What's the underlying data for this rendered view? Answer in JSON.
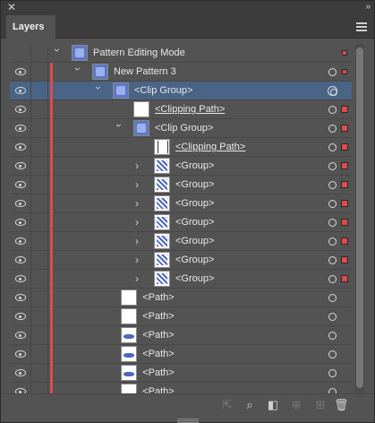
{
  "panel": {
    "close_glyph": "✕",
    "collapse_glyph": "»",
    "tab_label": "Layers"
  },
  "rows": [
    {
      "label": "Pattern Editing Mode",
      "eye": false,
      "color_bar": false,
      "caret": "down",
      "thumb": "blue",
      "indent": 1,
      "underline": false,
      "target": "none",
      "select": "small",
      "selected": false
    },
    {
      "label": "New Pattern 3",
      "eye": true,
      "color_bar": true,
      "caret": "down",
      "thumb": "blue",
      "indent": 2,
      "underline": false,
      "target": "single",
      "select": "small",
      "selected": false
    },
    {
      "label": "<Clip Group>",
      "eye": true,
      "color_bar": true,
      "caret": "down",
      "thumb": "blue",
      "indent": 3,
      "underline": false,
      "target": "double",
      "select": "none",
      "selected": true
    },
    {
      "label": "<Clipping Path>",
      "eye": true,
      "color_bar": true,
      "caret": "none",
      "thumb": "white",
      "indent": 4,
      "underline": true,
      "target": "single",
      "select": "square",
      "selected": false
    },
    {
      "label": "<Clip Group>",
      "eye": true,
      "color_bar": true,
      "caret": "down",
      "thumb": "blue",
      "indent": 4,
      "underline": false,
      "target": "single",
      "select": "square",
      "selected": false
    },
    {
      "label": "<Clipping Path>",
      "eye": true,
      "color_bar": true,
      "caret": "none",
      "thumb": "clip",
      "indent": 5,
      "underline": true,
      "target": "single",
      "select": "square",
      "selected": false
    },
    {
      "label": "<Group>",
      "eye": true,
      "color_bar": true,
      "caret": "right",
      "thumb": "pattern",
      "indent": 5,
      "underline": false,
      "target": "single",
      "select": "square",
      "selected": false
    },
    {
      "label": "<Group>",
      "eye": true,
      "color_bar": true,
      "caret": "right",
      "thumb": "pattern",
      "indent": 5,
      "underline": false,
      "target": "single",
      "select": "square",
      "selected": false
    },
    {
      "label": "<Group>",
      "eye": true,
      "color_bar": true,
      "caret": "right",
      "thumb": "pattern",
      "indent": 5,
      "underline": false,
      "target": "single",
      "select": "square",
      "selected": false
    },
    {
      "label": "<Group>",
      "eye": true,
      "color_bar": true,
      "caret": "right",
      "thumb": "pattern",
      "indent": 5,
      "underline": false,
      "target": "single",
      "select": "square",
      "selected": false
    },
    {
      "label": "<Group>",
      "eye": true,
      "color_bar": true,
      "caret": "right",
      "thumb": "pattern",
      "indent": 5,
      "underline": false,
      "target": "single",
      "select": "square",
      "selected": false
    },
    {
      "label": "<Group>",
      "eye": true,
      "color_bar": true,
      "caret": "right",
      "thumb": "pattern",
      "indent": 5,
      "underline": false,
      "target": "single",
      "select": "square",
      "selected": false
    },
    {
      "label": "<Group>",
      "eye": true,
      "color_bar": true,
      "caret": "right",
      "thumb": "pattern",
      "indent": 5,
      "underline": false,
      "target": "single",
      "select": "square",
      "selected": false
    },
    {
      "label": "<Path>",
      "eye": true,
      "color_bar": true,
      "caret": "none",
      "thumb": "white",
      "indent": 3.4,
      "underline": false,
      "target": "single",
      "select": "none",
      "selected": false
    },
    {
      "label": "<Path>",
      "eye": true,
      "color_bar": true,
      "caret": "none",
      "thumb": "white",
      "indent": 3.4,
      "underline": false,
      "target": "single",
      "select": "none",
      "selected": false
    },
    {
      "label": "<Path>",
      "eye": true,
      "color_bar": true,
      "caret": "none",
      "thumb": "spot",
      "indent": 3.4,
      "underline": false,
      "target": "single",
      "select": "none",
      "selected": false
    },
    {
      "label": "<Path>",
      "eye": true,
      "color_bar": true,
      "caret": "none",
      "thumb": "spot",
      "indent": 3.4,
      "underline": false,
      "target": "single",
      "select": "none",
      "selected": false
    },
    {
      "label": "<Path>",
      "eye": true,
      "color_bar": true,
      "caret": "none",
      "thumb": "spot",
      "indent": 3.4,
      "underline": false,
      "target": "single",
      "select": "none",
      "selected": false
    },
    {
      "label": "<Path>",
      "eye": true,
      "color_bar": true,
      "caret": "none",
      "thumb": "white",
      "indent": 3.4,
      "underline": false,
      "target": "single",
      "select": "none",
      "selected": false
    }
  ],
  "bottom_icons": [
    {
      "name": "export-icon",
      "glyph": "⇱",
      "dim": true
    },
    {
      "name": "search-icon",
      "glyph": "⌕",
      "dim": false
    },
    {
      "name": "clipping-mask-icon",
      "glyph": "◧",
      "dim": false
    },
    {
      "name": "sublayer-icon",
      "glyph": "⊕",
      "dim": true
    },
    {
      "name": "new-layer-icon",
      "glyph": "⊞",
      "dim": true
    },
    {
      "name": "trash-icon",
      "glyph": "🗑",
      "dim": false
    }
  ],
  "colors": {
    "layer_color": "#e04b4b",
    "selection_row": "#4a6486",
    "panel_bg": "#535353"
  }
}
